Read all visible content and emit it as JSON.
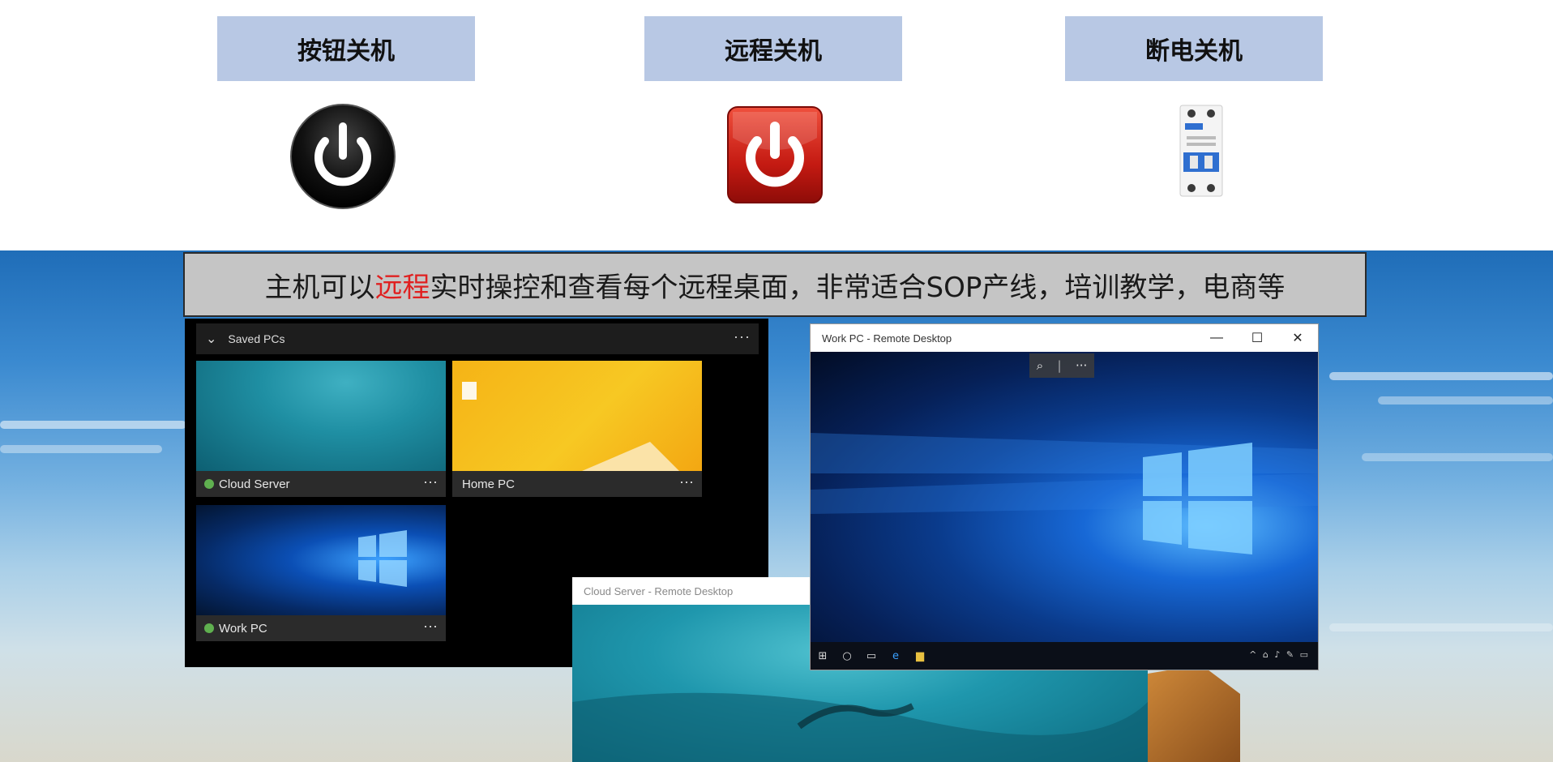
{
  "labels": {
    "button_shutdown": "按钮关机",
    "remote_shutdown": "远程关机",
    "power_cut_shutdown": "断电关机"
  },
  "banner": {
    "prefix": "主机可以",
    "highlight": "远程",
    "suffix": "实时操控和查看每个远程桌面，非常适合SOP产线，培训教学，电商等",
    "highlight_color": "#e02020"
  },
  "saved_pcs": {
    "header": "Saved PCs",
    "more": "···",
    "tiles": [
      {
        "name": "Cloud Server",
        "status": "online",
        "more": "···"
      },
      {
        "name": "Home PC",
        "more": "···"
      },
      {
        "name": "Work PC",
        "status": "online",
        "more": "···"
      }
    ]
  },
  "windows": {
    "work": {
      "title": "Work PC - Remote Desktop",
      "controls": {
        "minimize": "—",
        "maximize": "☐",
        "close": "✕"
      },
      "zoom_icon": "⌕",
      "zoom_more": "···",
      "taskbar_icons": [
        "windows-logo-icon",
        "cortana-icon",
        "task-view-icon",
        "edge-icon",
        "file-explorer-icon"
      ],
      "tray": "^ ⌂ ♪ ✎ ▭"
    },
    "cloud": {
      "title": "Cloud Server - Remote Desktop"
    }
  },
  "colors": {
    "label_bg": "#b8c8e4",
    "status_online": "#5fb04f"
  }
}
